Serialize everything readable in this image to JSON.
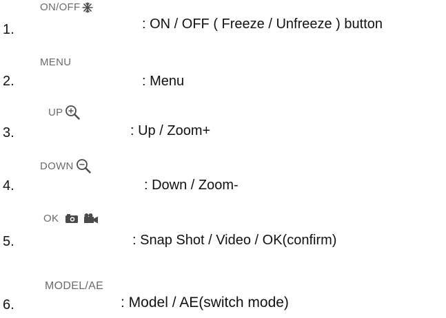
{
  "items": [
    {
      "number": "1.",
      "button_label": "ON/OFF",
      "icon": "snowflake-icon",
      "description": ": ON / OFF ( Freeze / Unfreeze ) button"
    },
    {
      "number": "2.",
      "button_label": "MENU",
      "icon": "",
      "description": ": Menu"
    },
    {
      "number": "3.",
      "button_label": "UP",
      "icon": "zoom-in-icon",
      "description": ": Up / Zoom+"
    },
    {
      "number": "4.",
      "button_label": "DOWN",
      "icon": "zoom-out-icon",
      "description": ": Down / Zoom-"
    },
    {
      "number": "5.",
      "button_label": "OK",
      "icon": "camera-video-icons",
      "description": ": Snap Shot / Video / OK(confirm)"
    },
    {
      "number": "6.",
      "button_label": "MODEL/AE",
      "icon": "",
      "description": ": Model / AE(switch mode)"
    }
  ],
  "colors": {
    "text": "#111111",
    "button_label": "#6a6a6a",
    "icon": "#4a4a4a"
  }
}
